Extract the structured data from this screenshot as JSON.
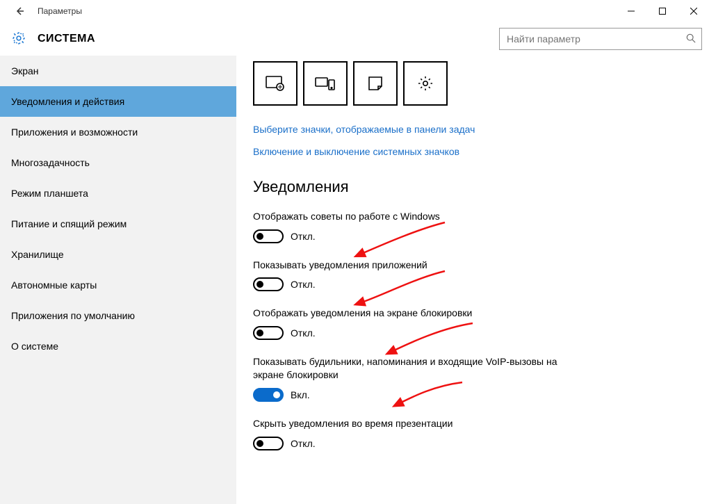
{
  "window": {
    "title": "Параметры"
  },
  "header": {
    "section": "СИСТЕМА",
    "search_placeholder": "Найти параметр"
  },
  "sidebar": {
    "items": [
      {
        "label": "Экран",
        "active": false
      },
      {
        "label": "Уведомления и действия",
        "active": true
      },
      {
        "label": "Приложения и возможности",
        "active": false
      },
      {
        "label": "Многозадачность",
        "active": false
      },
      {
        "label": "Режим планшета",
        "active": false
      },
      {
        "label": "Питание и спящий режим",
        "active": false
      },
      {
        "label": "Хранилище",
        "active": false
      },
      {
        "label": "Автономные карты",
        "active": false
      },
      {
        "label": "Приложения по умолчанию",
        "active": false
      },
      {
        "label": "О системе",
        "active": false
      }
    ]
  },
  "content": {
    "quick_tiles": [
      {
        "icon": "tablet-mode-icon"
      },
      {
        "icon": "connect-icon"
      },
      {
        "icon": "note-icon"
      },
      {
        "icon": "settings-icon"
      }
    ],
    "links": [
      "Выберите значки, отображаемые в панели задач",
      "Включение и выключение системных значков"
    ],
    "heading": "Уведомления",
    "toggles": [
      {
        "label": "Отображать советы по работе с Windows",
        "on": false,
        "state": "Откл."
      },
      {
        "label": "Показывать уведомления приложений",
        "on": false,
        "state": "Откл."
      },
      {
        "label": "Отображать уведомления на экране блокировки",
        "on": false,
        "state": "Откл."
      },
      {
        "label": "Показывать будильники, напоминания и входящие VoIP-вызовы на экране блокировки",
        "on": true,
        "state": "Вкл."
      },
      {
        "label": "Скрыть уведомления во время презентации",
        "on": false,
        "state": "Откл."
      }
    ]
  }
}
